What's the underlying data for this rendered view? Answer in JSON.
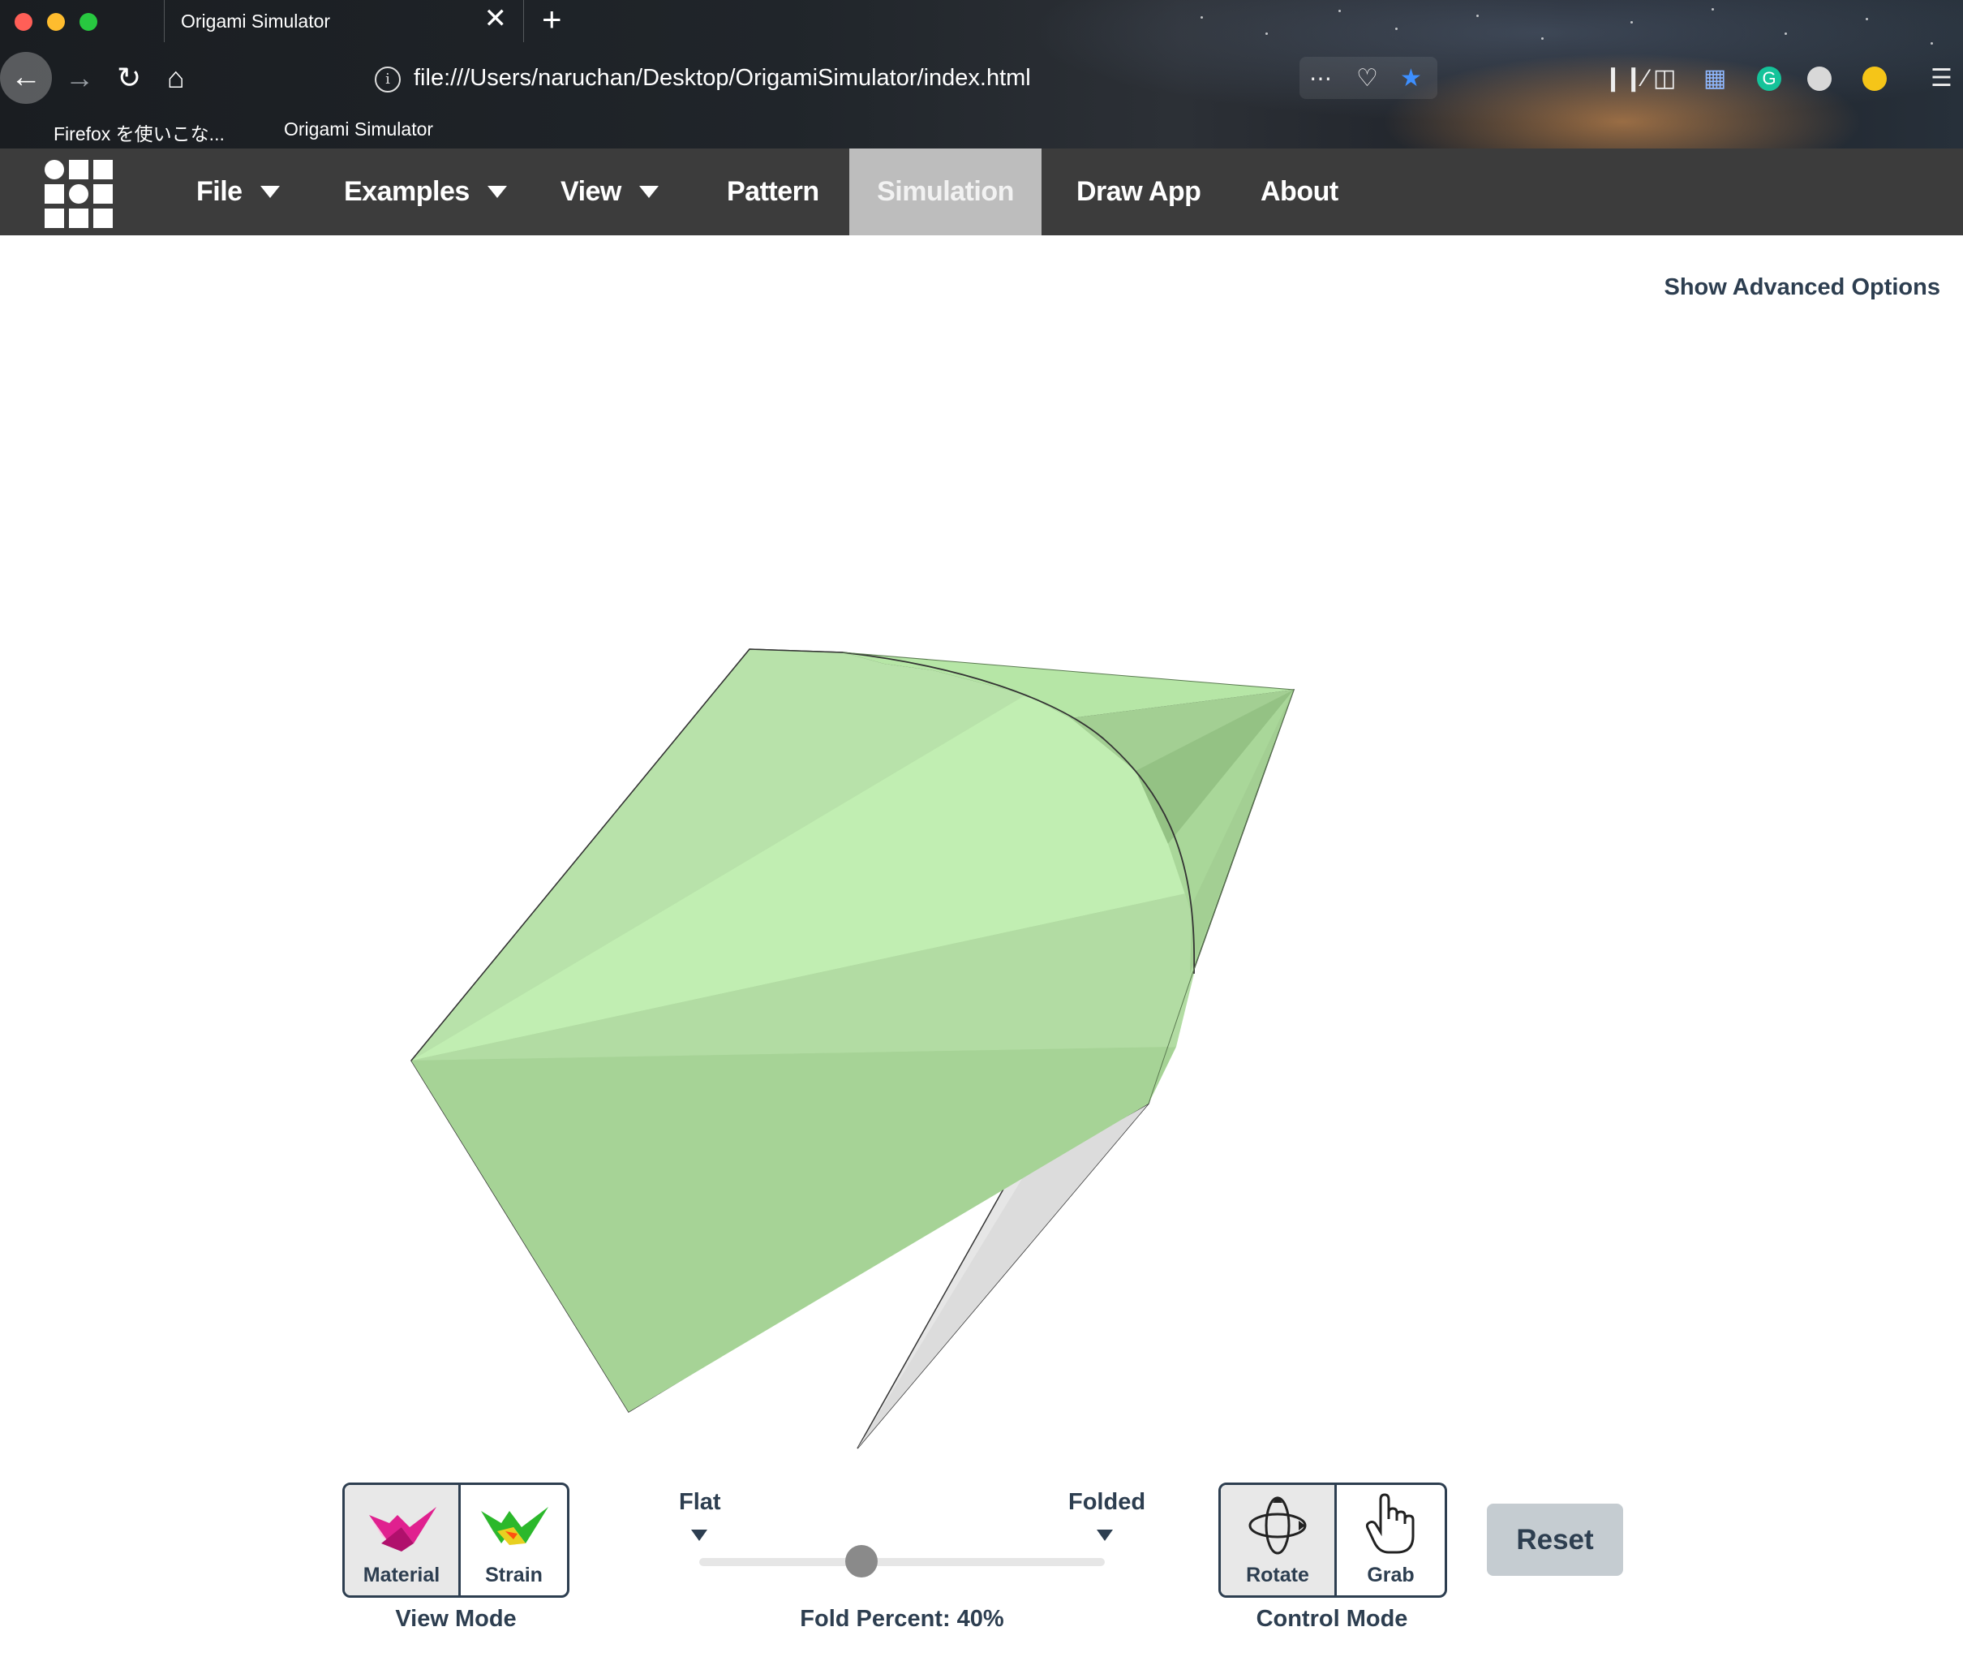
{
  "browser": {
    "tab_title": "Origami Simulator",
    "tab_close": "✕",
    "new_tab": "+",
    "url": "file:///Users/naruchan/Desktop/OrigamiSimulator/index.html",
    "bookmarks": [
      "Firefox を使いこな...",
      "Origami Simulator"
    ]
  },
  "navbar": {
    "items": [
      {
        "label": "File",
        "dropdown": true
      },
      {
        "label": "Examples",
        "dropdown": true
      },
      {
        "label": "View",
        "dropdown": true
      },
      {
        "label": "Pattern",
        "dropdown": false
      },
      {
        "label": "Simulation",
        "dropdown": false,
        "active": true
      },
      {
        "label": "Draw App",
        "dropdown": false
      },
      {
        "label": "About",
        "dropdown": false
      }
    ]
  },
  "advanced_options_link": "Show Advanced Options",
  "view_mode": {
    "caption": "View Mode",
    "buttons": [
      {
        "label": "Material",
        "active": true,
        "icon": "material-crane-icon"
      },
      {
        "label": "Strain",
        "active": false,
        "icon": "strain-crane-icon"
      }
    ]
  },
  "fold_slider": {
    "min_label": "Flat",
    "max_label": "Folded",
    "value": 0.4,
    "caption": "Fold Percent: 40%"
  },
  "control_mode": {
    "caption": "Control Mode",
    "buttons": [
      {
        "label": "Rotate",
        "active": true,
        "icon": "rotate-icon"
      },
      {
        "label": "Grab",
        "active": false,
        "icon": "hand-icon"
      }
    ]
  },
  "reset_label": "Reset",
  "colors": {
    "nav_bg": "#3c3c3c",
    "nav_active": "#bdbdbd",
    "text_dark": "#2d3e50",
    "paper_green": "#a8d598",
    "paper_back": "#e6e6e6"
  }
}
